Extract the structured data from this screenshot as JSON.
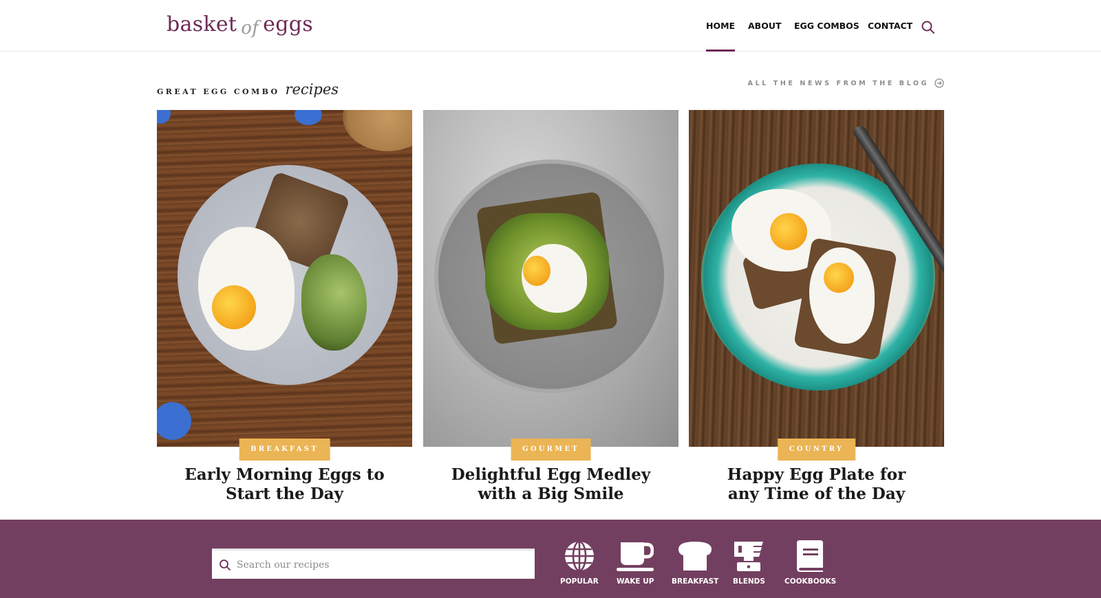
{
  "header": {
    "logo": {
      "word1": "basket",
      "word2": "of",
      "word3": "eggs"
    },
    "nav": [
      {
        "label": "HOME",
        "active": true
      },
      {
        "label": "ABOUT",
        "active": false
      },
      {
        "label": "EGG COMBOS",
        "active": false
      },
      {
        "label": "CONTACT",
        "active": false
      }
    ],
    "search_icon": "search-icon"
  },
  "section": {
    "title_caps": "GREAT EGG COMBO",
    "title_script": "recipes",
    "blog_link": "ALL THE NEWS FROM THE BLOG",
    "blog_link_icon": "arrow-circle-right-icon"
  },
  "cards": [
    {
      "category": "BREAKFAST",
      "title_line1": "Early Morning Eggs to",
      "title_line2": "Start the Day"
    },
    {
      "category": "GOURMET",
      "title_line1": "Delightful Egg Medley",
      "title_line2": "with a Big Smile"
    },
    {
      "category": "COUNTRY",
      "title_line1": "Happy Egg Plate for",
      "title_line2": "any Time of the Day"
    }
  ],
  "footer": {
    "search_placeholder": "Search our recipes",
    "categories": [
      {
        "label": "POPULAR",
        "icon": "globe-icon"
      },
      {
        "label": "WAKE UP",
        "icon": "coffee-cup-icon"
      },
      {
        "label": "BREAKFAST",
        "icon": "bread-icon"
      },
      {
        "label": "BLENDS",
        "icon": "blender-icon"
      },
      {
        "label": "COOKBOOKS",
        "icon": "book-icon"
      }
    ]
  },
  "colors": {
    "brand_purple": "#733f60",
    "logo_purple": "#6e2a56",
    "badge_gold": "#ebb454"
  }
}
